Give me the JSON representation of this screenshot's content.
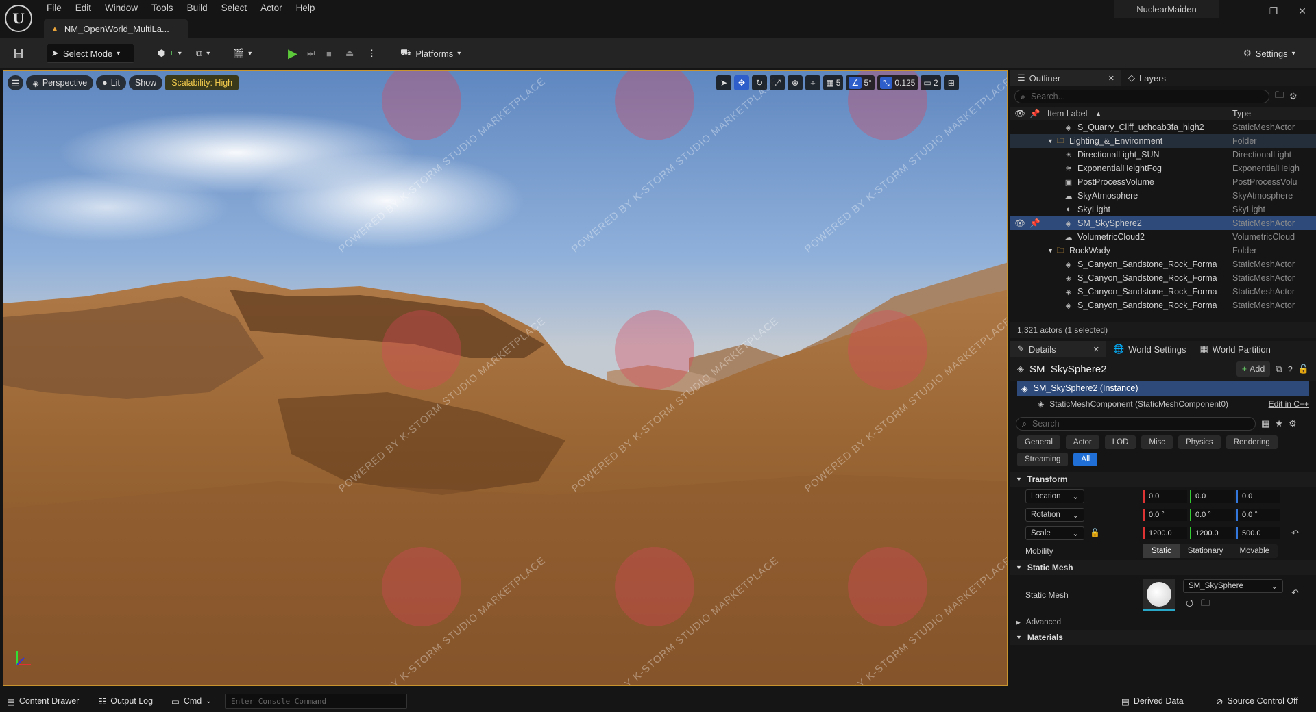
{
  "menu": [
    "File",
    "Edit",
    "Window",
    "Tools",
    "Build",
    "Select",
    "Actor",
    "Help"
  ],
  "doc_tab": "NM_OpenWorld_MultiLa...",
  "user": "NuclearMaiden",
  "toolbar": {
    "select_mode": "Select Mode",
    "platforms": "Platforms",
    "settings": "Settings"
  },
  "viewport": {
    "perspective": "Perspective",
    "lit": "Lit",
    "show": "Show",
    "scalability": "Scalability: High",
    "grid_snap": "5",
    "rot_snap": "5°",
    "scale_snap": "0.125",
    "camera_speed": "2",
    "watermark": "POWERED BY K-STORM STUDIO MARKETPLACE"
  },
  "outliner": {
    "tab": "Outliner",
    "layers_tab": "Layers",
    "search_placeholder": "Search...",
    "col_label": "Item Label",
    "col_type": "Type",
    "rows": [
      {
        "label": "S_Quarry_Cliff_uchoab3fa_high2",
        "type": "StaticMeshActor",
        "indent": 2,
        "icon": "mesh"
      },
      {
        "label": "Lighting_&_Environment",
        "type": "Folder",
        "indent": 1,
        "icon": "folder"
      },
      {
        "label": "DirectionalLight_SUN",
        "type": "DirectionalLight",
        "indent": 2,
        "icon": "sun"
      },
      {
        "label": "ExponentialHeightFog",
        "type": "ExponentialHeigh",
        "indent": 2,
        "icon": "fog"
      },
      {
        "label": "PostProcessVolume",
        "type": "PostProcessVolu",
        "indent": 2,
        "icon": "volume"
      },
      {
        "label": "SkyAtmosphere",
        "type": "SkyAtmosphere",
        "indent": 2,
        "icon": "sky"
      },
      {
        "label": "SkyLight",
        "type": "SkyLight",
        "indent": 2,
        "icon": "skylight"
      },
      {
        "label": "SM_SkySphere2",
        "type": "StaticMeshActor",
        "indent": 2,
        "icon": "mesh"
      },
      {
        "label": "VolumetricCloud2",
        "type": "VolumetricCloud",
        "indent": 2,
        "icon": "cloud"
      },
      {
        "label": "RockWady",
        "type": "Folder",
        "indent": 1,
        "icon": "folder"
      },
      {
        "label": "S_Canyon_Sandstone_Rock_Forma",
        "type": "StaticMeshActor",
        "indent": 2,
        "icon": "mesh"
      },
      {
        "label": "S_Canyon_Sandstone_Rock_Forma",
        "type": "StaticMeshActor",
        "indent": 2,
        "icon": "mesh"
      },
      {
        "label": "S_Canyon_Sandstone_Rock_Forma",
        "type": "StaticMeshActor",
        "indent": 2,
        "icon": "mesh"
      },
      {
        "label": "S_Canyon_Sandstone_Rock_Forma",
        "type": "StaticMeshActor",
        "indent": 2,
        "icon": "mesh"
      }
    ],
    "count": "1,321 actors (1 selected)"
  },
  "details": {
    "tab": "Details",
    "world_settings_tab": "World Settings",
    "world_partition_tab": "World Partition",
    "actor_name": "SM_SkySphere2",
    "add_label": "Add",
    "instance": "SM_SkySphere2 (Instance)",
    "component": "StaticMeshComponent (StaticMeshComponent0)",
    "edit_cpp": "Edit in C++",
    "search_placeholder": "Search",
    "categories": [
      "General",
      "Actor",
      "LOD",
      "Misc",
      "Physics",
      "Rendering",
      "Streaming",
      "All"
    ],
    "transform_label": "Transform",
    "location_label": "Location",
    "rotation_label": "Rotation",
    "scale_label": "Scale",
    "location": [
      "0.0",
      "0.0",
      "0.0"
    ],
    "rotation": [
      "0.0 °",
      "0.0 °",
      "0.0 °"
    ],
    "scale": [
      "1200.0",
      "1200.0",
      "500.0"
    ],
    "mobility_label": "Mobility",
    "mobility": [
      "Static",
      "Stationary",
      "Movable"
    ],
    "static_mesh_section": "Static Mesh",
    "static_mesh_label": "Static Mesh",
    "static_mesh_value": "SM_SkySphere",
    "advanced": "Advanced",
    "materials": "Materials"
  },
  "status": {
    "content_drawer": "Content Drawer",
    "output_log": "Output Log",
    "cmd": "Cmd",
    "console_placeholder": "Enter Console Command",
    "derived_data": "Derived Data",
    "source_control": "Source Control Off"
  }
}
